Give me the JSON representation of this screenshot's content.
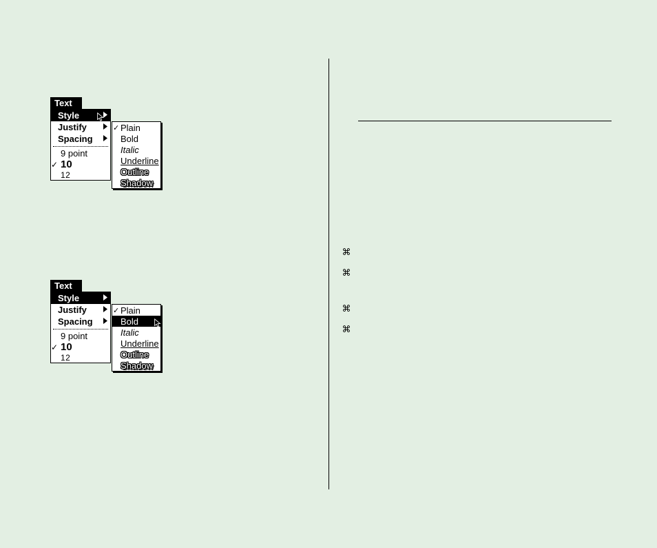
{
  "command_glyph": "⌘",
  "menu1": {
    "title": "Text",
    "items": [
      "Style",
      "Justify",
      "Spacing"
    ],
    "selected_index": 0,
    "sizes": {
      "nine": "9 point",
      "ten": "10",
      "twelve": "12"
    },
    "submenu": {
      "items": [
        "Plain",
        "Bold",
        "Italic",
        "Underline",
        "Outline",
        "Shadow"
      ],
      "checked_index": 0,
      "selected_index": null
    }
  },
  "menu2": {
    "title": "Text",
    "items": [
      "Style",
      "Justify",
      "Spacing"
    ],
    "selected_index": 0,
    "sizes": {
      "nine": "9 point",
      "ten": "10",
      "twelve": "12"
    },
    "submenu": {
      "items": [
        "Plain",
        "Bold",
        "Italic",
        "Underline",
        "Outline",
        "Shadow"
      ],
      "checked_index": 0,
      "selected_index": 1
    }
  }
}
